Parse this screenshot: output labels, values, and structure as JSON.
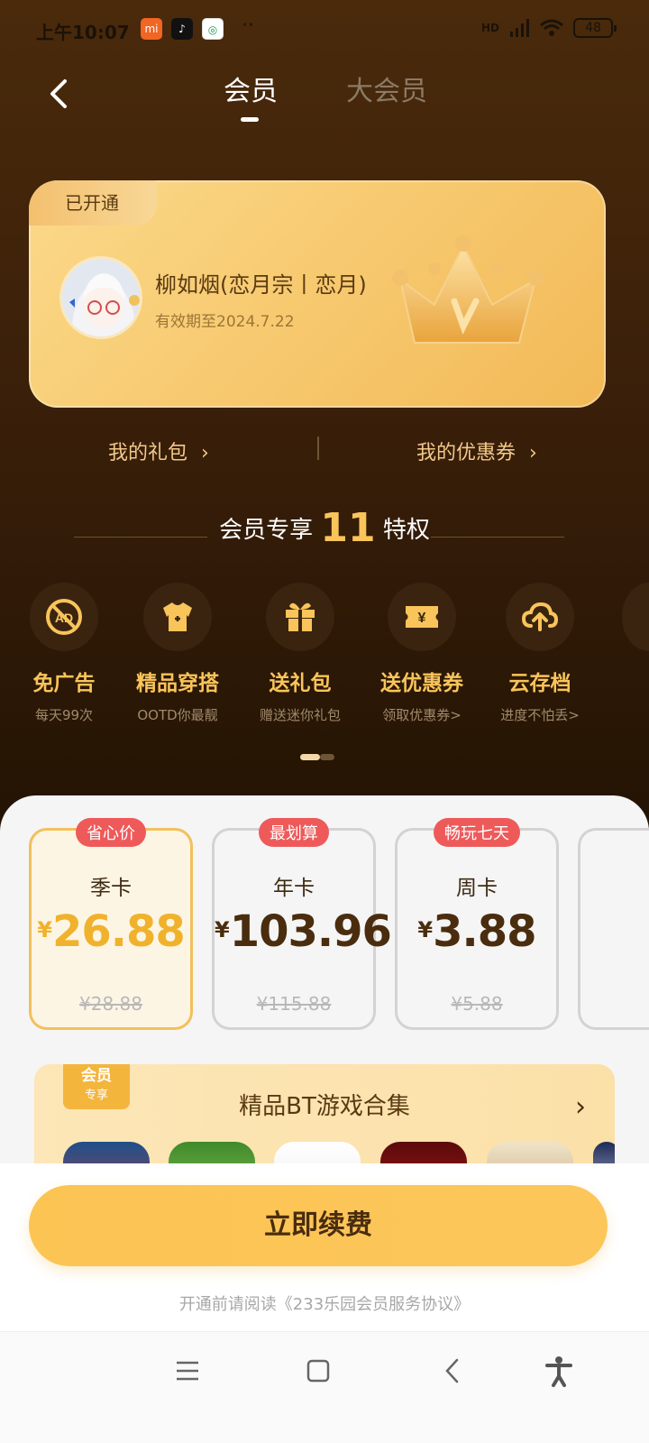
{
  "status_bar": {
    "time": "上午10:07",
    "app_icons": [
      {
        "name": "mi-icon",
        "glyph": "mi",
        "color": "#f26522"
      },
      {
        "name": "tiktok-icon",
        "glyph": "♪",
        "color": "#111111"
      },
      {
        "name": "china-mobile-icon",
        "glyph": "◎",
        "color": "#ffffff"
      }
    ],
    "more": "··",
    "network": "HD",
    "battery": "48"
  },
  "nav": {
    "tabs": [
      {
        "label": "会员",
        "active": true
      },
      {
        "label": "大会员",
        "active": false
      }
    ]
  },
  "member_card": {
    "badge": "已开通",
    "user_name": "柳如烟(恋月宗丨恋月)",
    "expiry": "有效期至2024.7.22",
    "crown_letter": "V"
  },
  "links": {
    "gift": "我的礼包",
    "coupon": "我的优惠券"
  },
  "privileges": {
    "heading_pre": "会员专享",
    "count": "11",
    "heading_post": "特权",
    "items": [
      {
        "icon": "no-ads-icon",
        "title": "免广告",
        "sub": "每天99次"
      },
      {
        "icon": "outfit-icon",
        "title": "精品穿搭",
        "sub": "OOTD你最靓"
      },
      {
        "icon": "gift-icon",
        "title": "送礼包",
        "sub": "赠送迷你礼包"
      },
      {
        "icon": "coupon-icon",
        "title": "送优惠券",
        "sub": "领取优惠券>"
      },
      {
        "icon": "cloud-save-icon",
        "title": "云存档",
        "sub": "进度不怕丢>"
      }
    ]
  },
  "plans": [
    {
      "badge": "省心价",
      "name": "季卡",
      "currency": "¥",
      "price": "26.88",
      "original": "¥28.88",
      "selected": true
    },
    {
      "badge": "最划算",
      "name": "年卡",
      "currency": "¥",
      "price": "103.96",
      "original": "¥115.88",
      "selected": false
    },
    {
      "badge": "畅玩七天",
      "name": "周卡",
      "currency": "¥",
      "price": "3.88",
      "original": "¥5.88",
      "selected": false
    }
  ],
  "bt_banner": {
    "tag_top": "会员",
    "tag_bottom": "专享",
    "title": "精品BT游戏合集"
  },
  "cta": {
    "label": "立即续费",
    "agreement": "开通前请阅读《233乐园会员服务协议》"
  },
  "colors": {
    "accent": "#f9c45a",
    "cta": "#fbc453",
    "badge_red": "#ee5a5a"
  }
}
